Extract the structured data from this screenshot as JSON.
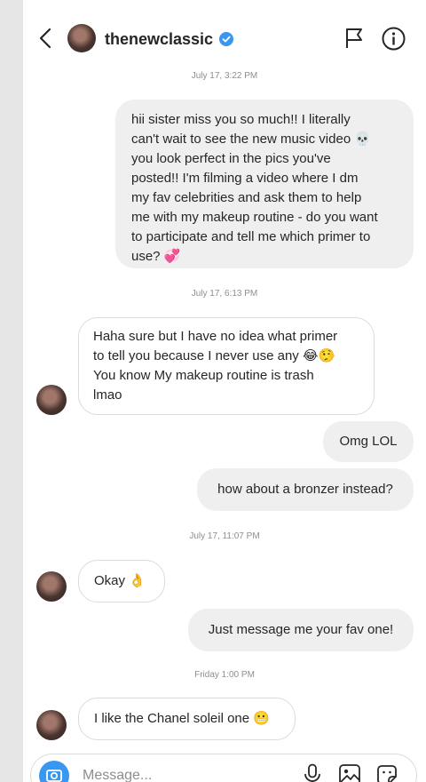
{
  "header": {
    "username": "thenewclassic"
  },
  "composer": {
    "placeholder": "Message..."
  },
  "thread": {
    "timestamps": [
      "July 17, 3:22 PM",
      "July 17, 6:13 PM",
      "July 17, 11:07 PM",
      "Friday 1:00 PM"
    ],
    "messages": [
      {
        "direction": "outgoing",
        "lines": [
          "hii sister miss you so much!! I literally",
          "can't wait to see the new music video 💀",
          "you look perfect in the pics you've",
          "posted!! I'm filming a video where I dm",
          "my fav celebrities and ask them to help",
          "me with my makeup routine - do you want",
          "to participate and tell me which primer to",
          "use? 💞"
        ]
      },
      {
        "direction": "incoming",
        "lines": [
          "Haha sure but I have no idea what primer",
          "to tell you because I never use any 😂🤥",
          "You know My makeup routine is trash",
          "lmao"
        ]
      },
      {
        "direction": "outgoing",
        "lines": [
          "Omg LOL"
        ]
      },
      {
        "direction": "outgoing",
        "lines": [
          "how about a bronzer instead?"
        ]
      },
      {
        "direction": "incoming",
        "lines": [
          "Okay 👌"
        ]
      },
      {
        "direction": "outgoing",
        "lines": [
          "Just message me your fav one!"
        ]
      },
      {
        "direction": "incoming",
        "lines": [
          "I like the Chanel soleil one 😬"
        ]
      }
    ]
  },
  "colors": {
    "verified": "#3897f0",
    "bubble_out": "#efefef",
    "bubble_in_border": "#dbdbdb",
    "timestamp": "#8e8e8e",
    "camera": "#3897f0"
  },
  "icons": [
    "back-chevron-icon",
    "verified-badge-icon",
    "flag-icon",
    "info-icon",
    "camera-icon",
    "microphone-icon",
    "gallery-icon",
    "sticker-icon"
  ]
}
